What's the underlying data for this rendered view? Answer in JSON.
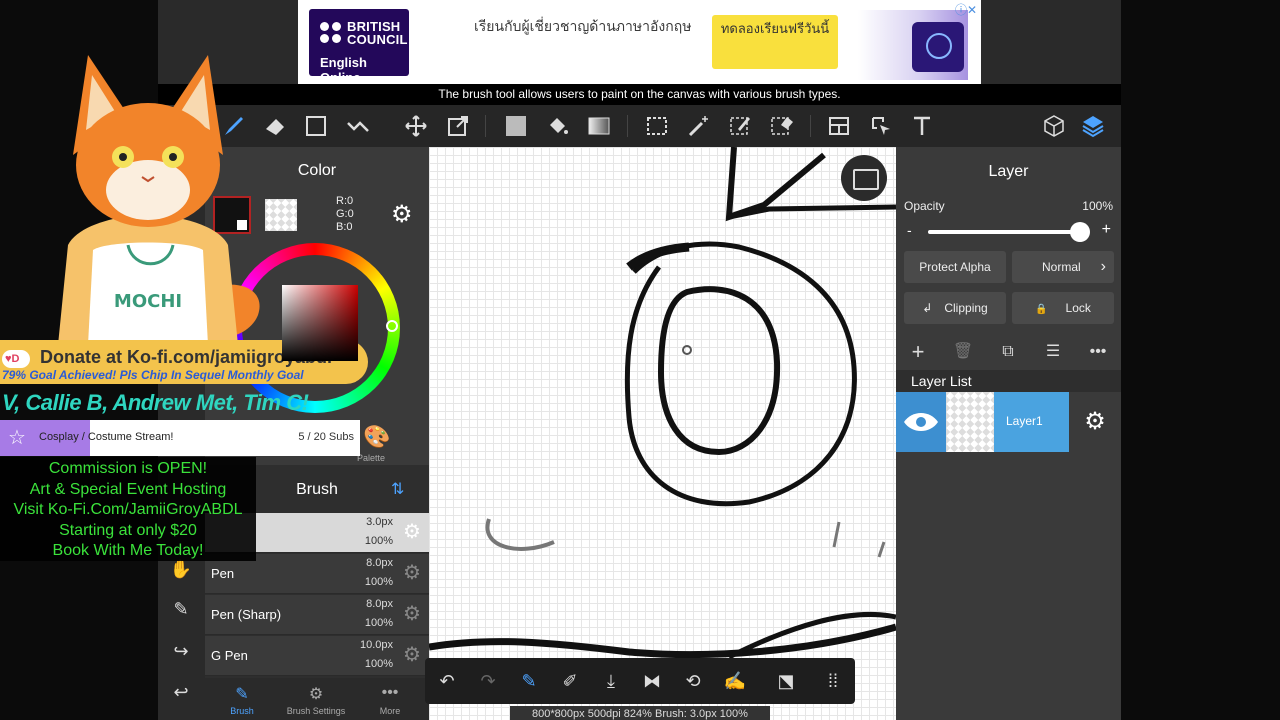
{
  "ad": {
    "brand": "BRITISH COUNCIL",
    "product": "English Online",
    "headline": "เรียนกับผู้เชี่ยวชาญด้านภาษาอังกฤษ",
    "cta": "ทดลองเรียนฟรีวันนี้"
  },
  "tooltip": "The brush tool allows users to paint on the canvas with various brush types.",
  "toolbar": {
    "tools": [
      "brush-icon",
      "eraser-icon",
      "rectangle-icon",
      "smudge-icon",
      "move-icon",
      "transform-icon",
      "fill-color-icon",
      "bucket-icon",
      "gradient-icon",
      "selection-icon",
      "magic-wand-icon",
      "selection-pen-icon",
      "selection-eraser-icon",
      "canvas-layout-icon",
      "select-tool-icon",
      "text-icon",
      "3d-icon",
      "layers-icon"
    ]
  },
  "color_panel": {
    "title": "Color",
    "r": "R:0",
    "g": "G:0",
    "b": "B:0",
    "palette_label": "Palette",
    "primary": "#000000"
  },
  "brush_panel": {
    "title": "Brush",
    "items": [
      {
        "name": "",
        "size": "3.0px",
        "opacity": "100%"
      },
      {
        "name": "Pen",
        "size": "8.0px",
        "opacity": "100%"
      },
      {
        "name": "Pen (Sharp)",
        "size": "8.0px",
        "opacity": "100%"
      },
      {
        "name": "G Pen",
        "size": "10.0px",
        "opacity": "100%"
      }
    ],
    "tabs": [
      "Brush",
      "Brush Settings",
      "More"
    ]
  },
  "status": "800*800px 500dpi 824% Brush: 3.0px 100%",
  "layer_panel": {
    "title": "Layer",
    "opacity_label": "Opacity",
    "opacity_value": "100%",
    "opacity_fraction": 1.0,
    "minus": "-",
    "plus": "+",
    "protect_alpha": "Protect Alpha",
    "blend_mode": "Normal",
    "clipping": "Clipping",
    "lock": "Lock",
    "list_header": "Layer List",
    "layers": [
      {
        "name": "Layer1",
        "visible": true
      }
    ]
  },
  "overlay": {
    "donate": "Donate at Ko-fi.com/jamiigroyabdl",
    "goal_line": "79% Goal Achieved! Pls Chip In Sequel Monthly Goal",
    "supporters": "V, Callie B, Andrew Met, Tim C!",
    "sub_goal": {
      "label": "Cosplay / Costume Stream!",
      "count": "5 / 20 Subs",
      "progress": 0.25
    },
    "commission": [
      "Commission is OPEN!",
      "Art & Special Event Hosting",
      "Visit Ko-Fi.Com/JamiiGroyABDL",
      "Starting at only $20",
      "Book With Me Today!"
    ],
    "shirt_text": "MOCHI"
  },
  "colors": {
    "accent": "#4aa3e0",
    "commission_text": "#3be23b",
    "donate_bg": "#f3c34c",
    "goal_fill": "#a77be6"
  }
}
